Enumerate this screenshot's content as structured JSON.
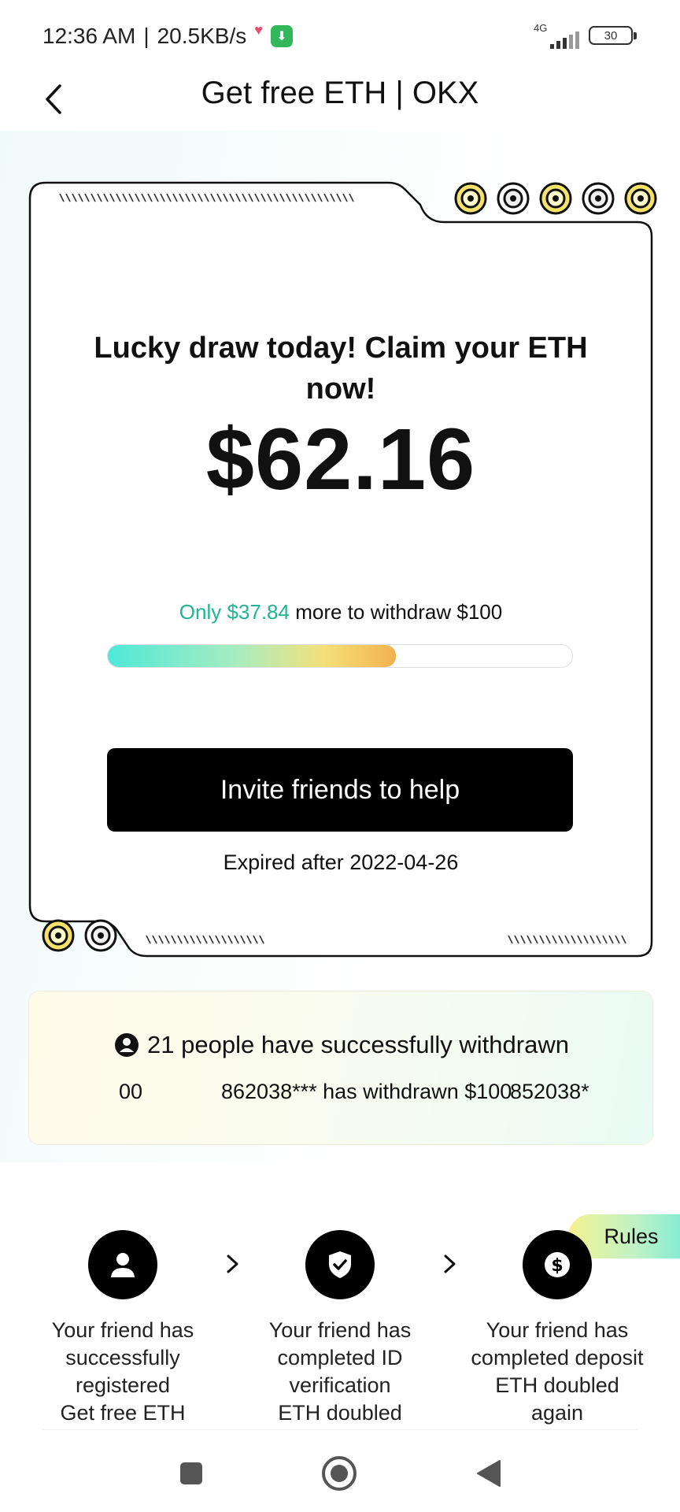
{
  "status_bar": {
    "time": "12:36 AM",
    "separator": "|",
    "speed": "20.5KB/s",
    "network": "4G",
    "battery": "30"
  },
  "header": {
    "title": "Get free ETH | OKX"
  },
  "card": {
    "headline": "Lucky draw today! Claim your ETH now!",
    "amount": "$62.16",
    "progress_highlight": "Only $37.84",
    "progress_rest": " more to withdraw $100",
    "progress_fraction": 0.62,
    "invite_label": "Invite friends to help",
    "expiry": "Expired after 2022-04-26"
  },
  "withdrawals": {
    "title": "21 people have successfully withdrawn",
    "ticker": [
      "00",
      "862038*** has withdrawn $100",
      "852038*"
    ]
  },
  "rules_label": "Rules",
  "steps": [
    {
      "icon": "user-icon",
      "text": [
        "Your friend has",
        "successfully",
        "registered",
        "Get free ETH"
      ]
    },
    {
      "icon": "shield-check-icon",
      "text": [
        "Your friend has",
        "completed ID",
        "verification",
        "ETH doubled"
      ]
    },
    {
      "icon": "dollar-icon",
      "text": [
        "Your friend has",
        "completed deposit",
        "ETH doubled",
        "again"
      ]
    }
  ],
  "colors": {
    "accent_green": "#1fb591",
    "progress_start": "#4fe8d8",
    "progress_end": "#f2b24e",
    "button_bg": "#000000"
  }
}
